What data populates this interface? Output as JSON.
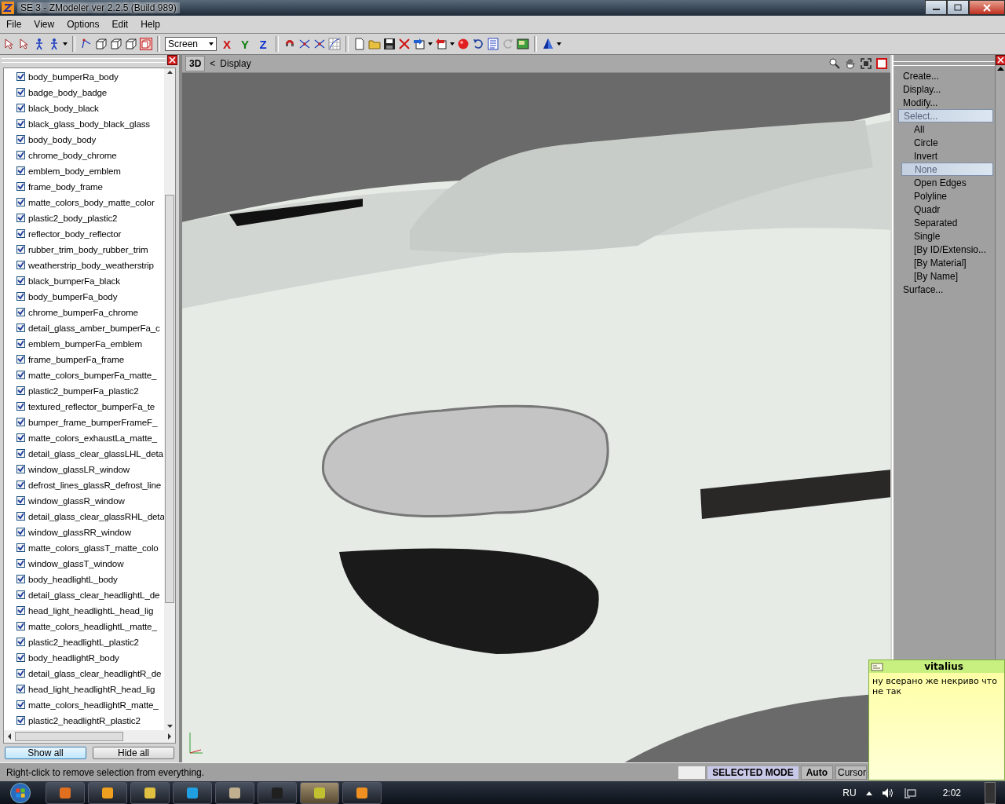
{
  "window": {
    "title": "SE 3 - ZModeler ver 2.2.5 (Build 989)"
  },
  "menu": [
    "File",
    "View",
    "Options",
    "Edit",
    "Help"
  ],
  "toolbar": {
    "space": "Screen",
    "axes": [
      {
        "label": "X",
        "color": "#d01010"
      },
      {
        "label": "Y",
        "color": "#108010"
      },
      {
        "label": "Z",
        "color": "#1030d0"
      }
    ]
  },
  "objects": [
    {
      "name": "body_bumperRa_body",
      "checked": true
    },
    {
      "name": "badge_body_badge",
      "checked": true
    },
    {
      "name": "black_body_black",
      "checked": true
    },
    {
      "name": "black_glass_body_black_glass",
      "checked": true
    },
    {
      "name": "body_body_body",
      "checked": true
    },
    {
      "name": "chrome_body_chrome",
      "checked": true
    },
    {
      "name": "emblem_body_emblem",
      "checked": true
    },
    {
      "name": "frame_body_frame",
      "checked": true
    },
    {
      "name": "matte_colors_body_matte_color",
      "checked": true
    },
    {
      "name": "plastic2_body_plastic2",
      "checked": true
    },
    {
      "name": "reflector_body_reflector",
      "checked": true
    },
    {
      "name": "rubber_trim_body_rubber_trim",
      "checked": true
    },
    {
      "name": "weatherstrip_body_weatherstrip",
      "checked": true
    },
    {
      "name": "black_bumperFa_black",
      "checked": true
    },
    {
      "name": "body_bumperFa_body",
      "checked": true
    },
    {
      "name": "chrome_bumperFa_chrome",
      "checked": true
    },
    {
      "name": "detail_glass_amber_bumperFa_c",
      "checked": true
    },
    {
      "name": "emblem_bumperFa_emblem",
      "checked": true
    },
    {
      "name": "frame_bumperFa_frame",
      "checked": true
    },
    {
      "name": "matte_colors_bumperFa_matte_",
      "checked": true
    },
    {
      "name": "plastic2_bumperFa_plastic2",
      "checked": true
    },
    {
      "name": "textured_reflector_bumperFa_te",
      "checked": true
    },
    {
      "name": "bumper_frame_bumperFrameF_",
      "checked": true
    },
    {
      "name": "matte_colors_exhaustLa_matte_",
      "checked": true
    },
    {
      "name": "detail_glass_clear_glassLHL_deta",
      "checked": true
    },
    {
      "name": "window_glassLR_window",
      "checked": true
    },
    {
      "name": "defrost_lines_glassR_defrost_line",
      "checked": true
    },
    {
      "name": "window_glassR_window",
      "checked": true
    },
    {
      "name": "detail_glass_clear_glassRHL_deta",
      "checked": true
    },
    {
      "name": "window_glassRR_window",
      "checked": true
    },
    {
      "name": "matte_colors_glassT_matte_colo",
      "checked": true
    },
    {
      "name": "window_glassT_window",
      "checked": true
    },
    {
      "name": "body_headlightL_body",
      "checked": true
    },
    {
      "name": "detail_glass_clear_headlightL_de",
      "checked": true
    },
    {
      "name": "head_light_headlightL_head_lig",
      "checked": true
    },
    {
      "name": "matte_colors_headlightL_matte_",
      "checked": true
    },
    {
      "name": "plastic2_headlightL_plastic2",
      "checked": true
    },
    {
      "name": "body_headlightR_body",
      "checked": true
    },
    {
      "name": "detail_glass_clear_headlightR_de",
      "checked": true
    },
    {
      "name": "head_light_headlightR_head_lig",
      "checked": true
    },
    {
      "name": "matte_colors_headlightR_matte_",
      "checked": true
    },
    {
      "name": "plastic2_headlightR_plastic2",
      "checked": true
    }
  ],
  "panel_buttons": [
    {
      "label": "Show all",
      "selected": true
    },
    {
      "label": "Hide all",
      "selected": false
    }
  ],
  "viewport": {
    "mode": "3D",
    "back": "<",
    "title": "Display"
  },
  "command_tree": [
    {
      "label": "Create...",
      "kind": "group",
      "selected": false
    },
    {
      "label": "Display...",
      "kind": "group",
      "selected": false
    },
    {
      "label": "Modify...",
      "kind": "group",
      "selected": false
    },
    {
      "label": "Select...",
      "kind": "group",
      "selected": true
    },
    {
      "label": "All",
      "kind": "command",
      "selected": false
    },
    {
      "label": "Circle",
      "kind": "command",
      "selected": false
    },
    {
      "label": "Invert",
      "kind": "command",
      "selected": false
    },
    {
      "label": "None",
      "kind": "command",
      "selected": true
    },
    {
      "label": "Open Edges",
      "kind": "command",
      "selected": false
    },
    {
      "label": "Polyline",
      "kind": "command",
      "selected": false
    },
    {
      "label": "Quadr",
      "kind": "command",
      "selected": false
    },
    {
      "label": "Separated",
      "kind": "command",
      "selected": false
    },
    {
      "label": "Single",
      "kind": "command",
      "selected": false
    },
    {
      "label": "[By ID/Extensio...",
      "kind": "command",
      "selected": false
    },
    {
      "label": "[By Material]",
      "kind": "command",
      "selected": false
    },
    {
      "label": "[By Name]",
      "kind": "command",
      "selected": false
    },
    {
      "label": "Surface...",
      "kind": "group",
      "selected": false
    }
  ],
  "status_bar": {
    "hint": "Right-click to remove selection from everything.",
    "mode": "SELECTED MODE",
    "snap": "Auto",
    "cursor": "Cursor"
  },
  "note": {
    "author": "vitalius",
    "text": "ну всерано же некриво что не так"
  },
  "taskbar": {
    "apps": [
      {
        "selected": false
      },
      {
        "selected": false
      },
      {
        "selected": false
      },
      {
        "selected": false
      },
      {
        "selected": false
      },
      {
        "selected": false
      },
      {
        "selected": true
      },
      {
        "selected": false
      }
    ],
    "language": "RU",
    "clock": "2:02"
  }
}
